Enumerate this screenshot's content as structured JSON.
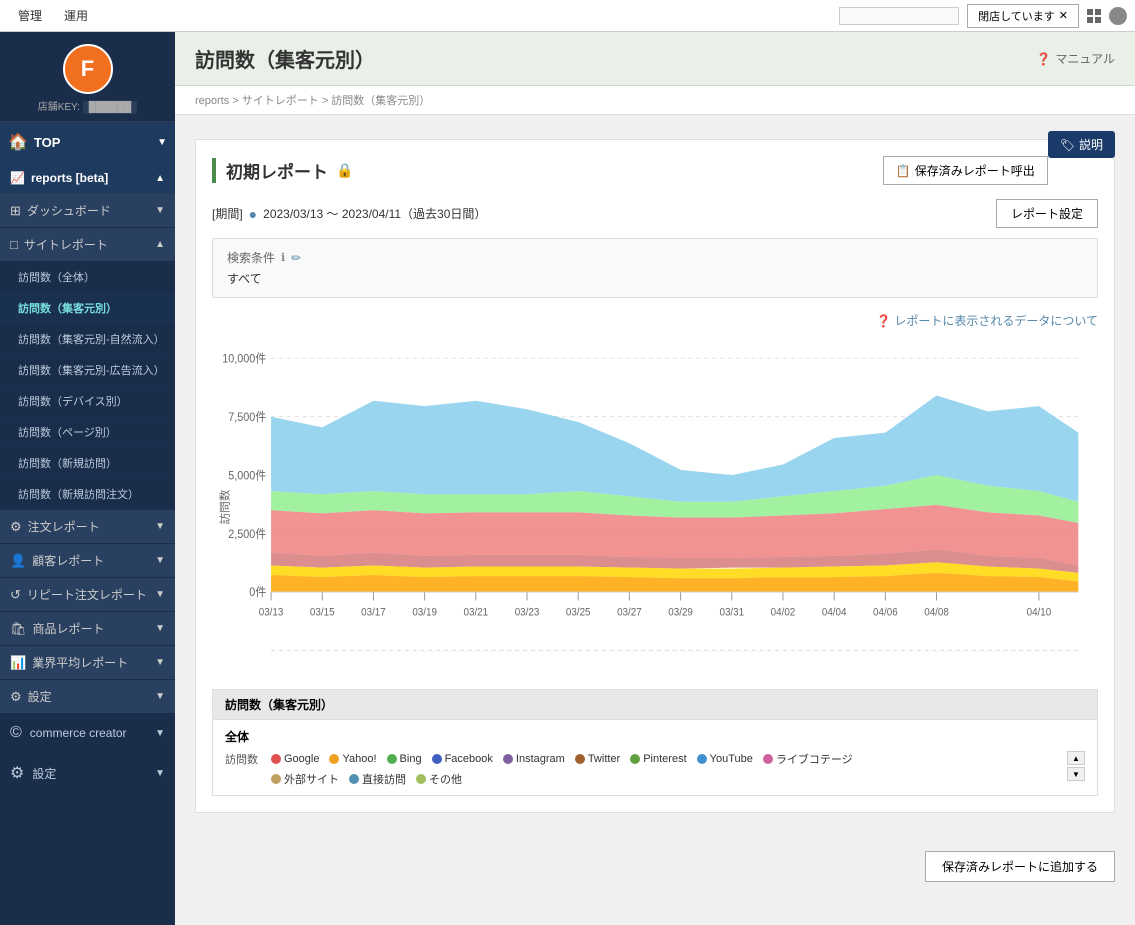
{
  "topbar": {
    "nav_items": [
      "管理",
      "運用"
    ],
    "search_placeholder": "",
    "store_status": "閉店しています",
    "store_status_label": "閉店しています"
  },
  "sidebar": {
    "logo_letter": "F",
    "store_key_label": "店舗KEY:",
    "store_key_value": "██████",
    "top_button": "TOP",
    "reports_label": "reports [beta]",
    "sections": [
      {
        "icon": "⊞",
        "label": "ダッシュボード",
        "has_arrow": true
      },
      {
        "icon": "□",
        "label": "サイトレポート",
        "has_arrow": true,
        "expanded": true
      }
    ],
    "site_report_items": [
      "訪問数（全体）",
      "訪問数（集客元別）",
      "訪問数（集客元別-自然流入）",
      "訪問数（集客元別-広告流入）",
      "訪問数（デバイス別）",
      "訪問数（ページ別）",
      "訪問数（新規訪問）",
      "訪問数（新規訪問注文）"
    ],
    "active_item": "訪問数（集客元別）",
    "bottom_sections": [
      {
        "icon": "⚙",
        "label": "注文レポート",
        "has_arrow": true
      },
      {
        "icon": "👤",
        "label": "顧客レポート",
        "has_arrow": true
      },
      {
        "icon": "↺",
        "label": "リピート注文レポート",
        "has_arrow": true
      },
      {
        "icon": "🛍",
        "label": "商品レポート",
        "has_arrow": true
      },
      {
        "icon": "📊",
        "label": "業界平均レポート",
        "has_arrow": true
      },
      {
        "icon": "⚙",
        "label": "設定",
        "has_arrow": true
      }
    ],
    "commerce_creator_label": "commerce creator",
    "settings_label": "設定"
  },
  "page": {
    "title": "訪問数（集客元別）",
    "manual_label": "マニュアル",
    "breadcrumb": "reports > サイトレポート > 訪問数（集客元別）",
    "explain_label": "説明",
    "report_title": "初期レポート",
    "saved_report_btn": "保存済みレポート呼出",
    "period_label": "[期間]",
    "period_value": "2023/03/13 〜 2023/04/11（過去30日間）",
    "report_settings_btn": "レポート設定",
    "search_conditions_label": "検索条件",
    "search_conditions_value": "すべて",
    "chart_info_link": "❓ レポートに表示されるデータについて",
    "save_to_report_btn": "保存済みレポートに追加する"
  },
  "chart": {
    "y_axis_label": "訪問数",
    "y_ticks": [
      "10,000件",
      "7,500件",
      "5,000件",
      "2,500件",
      "0件"
    ],
    "x_ticks": [
      "03/13",
      "03/15",
      "03/17",
      "03/19",
      "03/21",
      "03/23",
      "03/25",
      "03/27",
      "03/29",
      "03/31",
      "04/02",
      "04/04",
      "04/06",
      "04/08",
      "04/10"
    ]
  },
  "legend": {
    "table_title": "訪問数（集客元別）",
    "total_label": "全体",
    "visit_label": "訪問数",
    "items": [
      {
        "color": "#e05050",
        "label": "Google"
      },
      {
        "color": "#f0a020",
        "label": "Yahoo!"
      },
      {
        "color": "#50b050",
        "label": "Bing"
      },
      {
        "color": "#4060c0",
        "label": "Facebook"
      },
      {
        "color": "#8060a0",
        "label": "Instagram"
      },
      {
        "color": "#a06030",
        "label": "Twitter"
      },
      {
        "color": "#60a040",
        "label": "Pinterest"
      },
      {
        "color": "#4090d0",
        "label": "YouTube"
      },
      {
        "color": "#d060a0",
        "label": "ライブコテージ"
      }
    ],
    "row2_items": [
      {
        "color": "#c0a060",
        "label": "外部サイト"
      },
      {
        "color": "#5090b0",
        "label": "直接訪問"
      },
      {
        "color": "#a0c060",
        "label": "その他"
      }
    ]
  }
}
